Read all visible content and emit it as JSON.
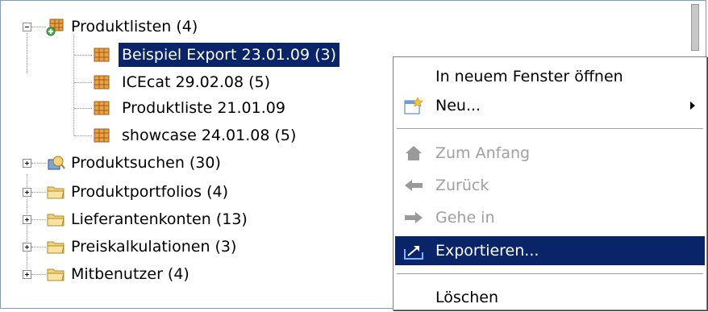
{
  "tree": {
    "items": [
      {
        "label": "Produktlisten (4)",
        "expanded": true,
        "icon": "product-list-group-icon"
      },
      {
        "label": "Beispiel Export 23.01.09 (3)",
        "selected": true,
        "icon": "product-list-icon"
      },
      {
        "label": "ICEcat 29.02.08 (5)",
        "icon": "product-list-icon"
      },
      {
        "label": "Produktliste 21.01.09",
        "icon": "product-list-icon"
      },
      {
        "label": "showcase 24.01.08 (5)",
        "icon": "product-list-icon"
      },
      {
        "label": "Produktsuchen (30)",
        "expanded": false,
        "icon": "product-search-icon"
      },
      {
        "label": "Produktportfolios (4)",
        "expanded": false,
        "icon": "folder-icon"
      },
      {
        "label": "Lieferantenkonten (13)",
        "expanded": false,
        "icon": "folder-icon"
      },
      {
        "label": "Preiskalkulationen (3)",
        "expanded": false,
        "icon": "folder-icon"
      },
      {
        "label": "Mitbenutzer (4)",
        "expanded": false,
        "icon": "folder-icon"
      }
    ]
  },
  "context_menu": {
    "items": [
      {
        "label": "In neuem Fenster öffnen",
        "enabled": true
      },
      {
        "label": "Neu...",
        "enabled": true,
        "submenu": true,
        "icon": "new-icon"
      },
      {
        "label": "Zum Anfang",
        "enabled": false,
        "icon": "home-icon"
      },
      {
        "label": "Zurück",
        "enabled": false,
        "icon": "back-arrow-icon"
      },
      {
        "label": "Gehe in",
        "enabled": false,
        "icon": "forward-arrow-icon"
      },
      {
        "label": "Exportieren...",
        "enabled": true,
        "highlighted": true,
        "icon": "export-icon"
      },
      {
        "label": "Löschen",
        "enabled": true
      }
    ]
  },
  "colors": {
    "selection": "#0a246a",
    "disabled_text": "#a0a0a0",
    "folder": "#f2d37a",
    "list_icon": "#d9822b"
  }
}
